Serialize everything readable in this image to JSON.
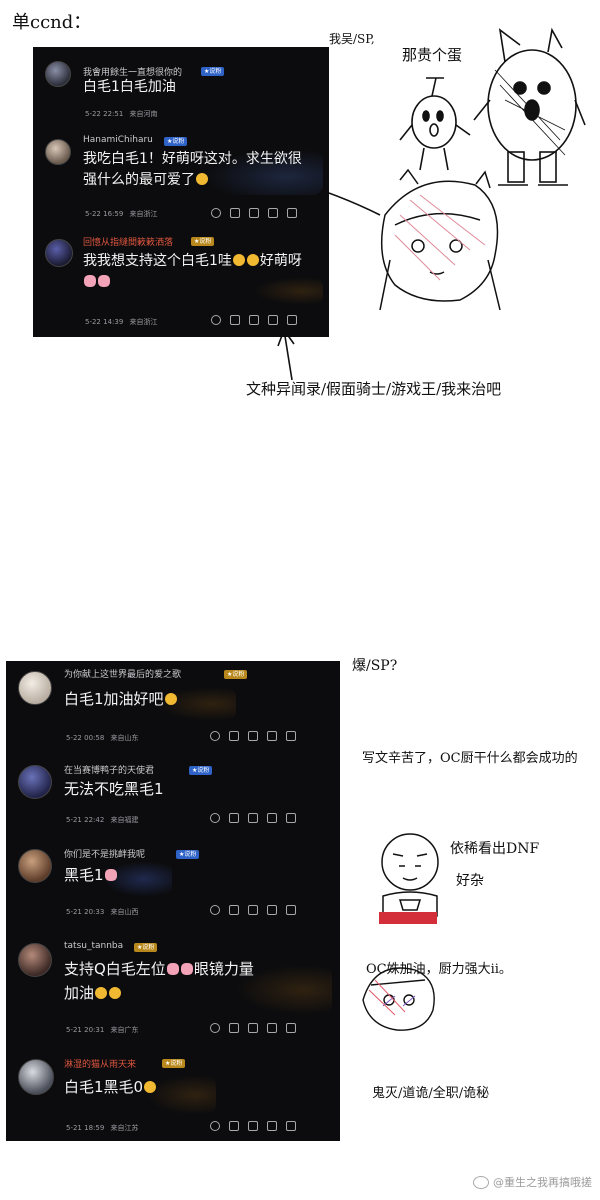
{
  "annotations": {
    "top_left": "单ccnd：",
    "top_char_small": "我吴/SP,",
    "top_char_big": "那贵个蛋",
    "bottom_right_line": "文种异闻录/假面骑士/游戏王/我来治吧",
    "mid_right": "爆/SP?",
    "right_note1": "写文辛苦了，OC厨干什么都会成功的",
    "right_note2a": "依稀看出DNF",
    "right_note2b": "好杂",
    "right_note3": "OC姝加油，厨力强大ⅱ。",
    "right_note4": "鬼灭/道诡/全职/诡秘"
  },
  "panel1": {
    "comments": [
      {
        "username": "我會用餘生一直想很你的",
        "badge": "★说粉",
        "text": "白毛1白毛加油",
        "date": "5-22 22:51",
        "location": "来自河南"
      },
      {
        "username": "HanamiChiharu",
        "badge": "★说粉",
        "text": "我吃白毛1！好萌呀这对。求生欲很强什么的最可爱了",
        "date": "5-22 16:59",
        "location": "来自浙江"
      },
      {
        "username": "回憶从指縫間簌簌洒落",
        "badge": "★说粉",
        "text": "我我想支持这个白毛1哇",
        "text2": "好萌呀",
        "date": "5-22 14:39",
        "location": "来自浙江"
      }
    ]
  },
  "panel2": {
    "comments": [
      {
        "username": "为你献上这世界最后的爱之歌",
        "badge": "★说粉",
        "text": "白毛1加油好吧",
        "date": "5-22 00:58",
        "location": "来自山东"
      },
      {
        "username": "在当赛博鸭子的天使君",
        "badge": "★说粉",
        "text": "无法不吃黑毛1",
        "date": "5-21 22:42",
        "location": "来自福建"
      },
      {
        "username": "你们是不是挑衅我呢",
        "badge": "★说粉",
        "text": "黑毛1",
        "date": "5-21 20:33",
        "location": "来自山西"
      },
      {
        "username": "tatsu_tannba",
        "badge": "★说粉",
        "text": "支持Q白毛左位",
        "text_b": "眼镜力量",
        "text2": "加油",
        "date": "5-21 20:31",
        "location": "来自广东"
      },
      {
        "username": "淋湿的猫从雨天来",
        "badge": "★说粉",
        "text": "白毛1黑毛0",
        "date": "5-21 18:59",
        "location": "来自江苏"
      }
    ]
  },
  "watermark": "@重生之我再搞哦搓"
}
